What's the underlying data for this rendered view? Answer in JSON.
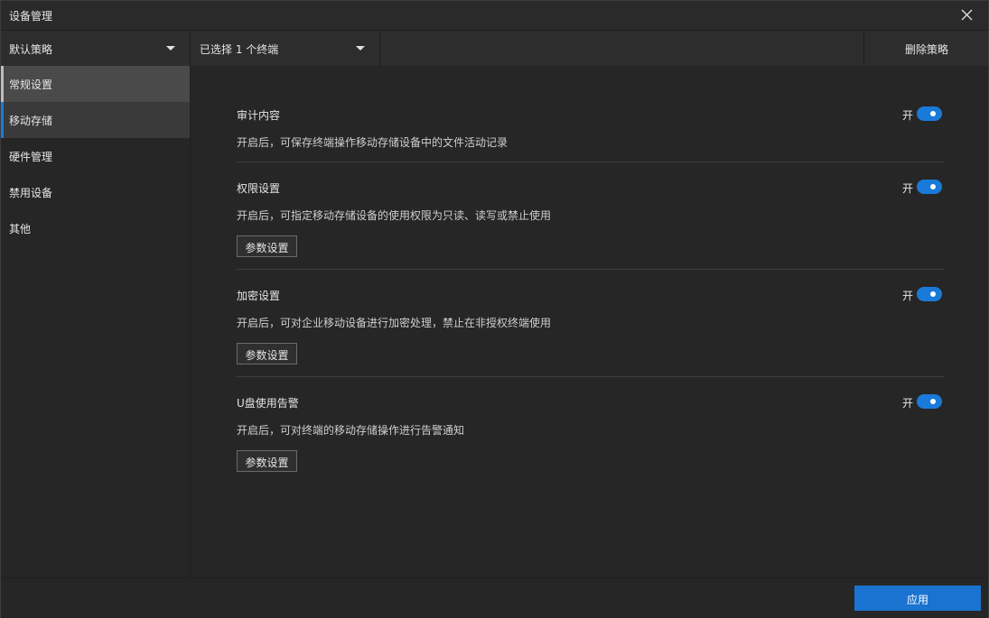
{
  "window": {
    "title": "设备管理",
    "close_icon": "close-icon"
  },
  "toolbar": {
    "policy_dropdown": "默认策略",
    "terminal_dropdown": "已选择 1 个终端",
    "delete_label": "删除策略"
  },
  "sidebar": {
    "items": [
      {
        "label": "常规设置",
        "state": "hover"
      },
      {
        "label": "移动存储",
        "state": "active"
      },
      {
        "label": "硬件管理",
        "state": "normal"
      },
      {
        "label": "禁用设备",
        "state": "normal"
      },
      {
        "label": "其他",
        "state": "normal"
      }
    ]
  },
  "sections": [
    {
      "title": "审计内容",
      "desc": "开启后，可保存终端操作移动存储设备中的文件活动记录",
      "toggle_label": "开",
      "enabled": true
    },
    {
      "title": "权限设置",
      "desc": "开启后，可指定移动存储设备的使用权限为只读、读写或禁止使用",
      "toggle_label": "开",
      "enabled": true,
      "button": "参数设置"
    },
    {
      "title": "加密设置",
      "desc": "开启后，可对企业移动设备进行加密处理，禁止在非授权终端使用",
      "toggle_label": "开",
      "enabled": true,
      "button": "参数设置"
    },
    {
      "title": "U盘使用告警",
      "desc": "开启后，可对终端的移动存储操作进行告警通知",
      "toggle_label": "开",
      "enabled": true,
      "button": "参数设置"
    }
  ],
  "footer": {
    "apply_label": "应用"
  },
  "colors": {
    "accent": "#1a7ad9",
    "background": "#262626"
  }
}
